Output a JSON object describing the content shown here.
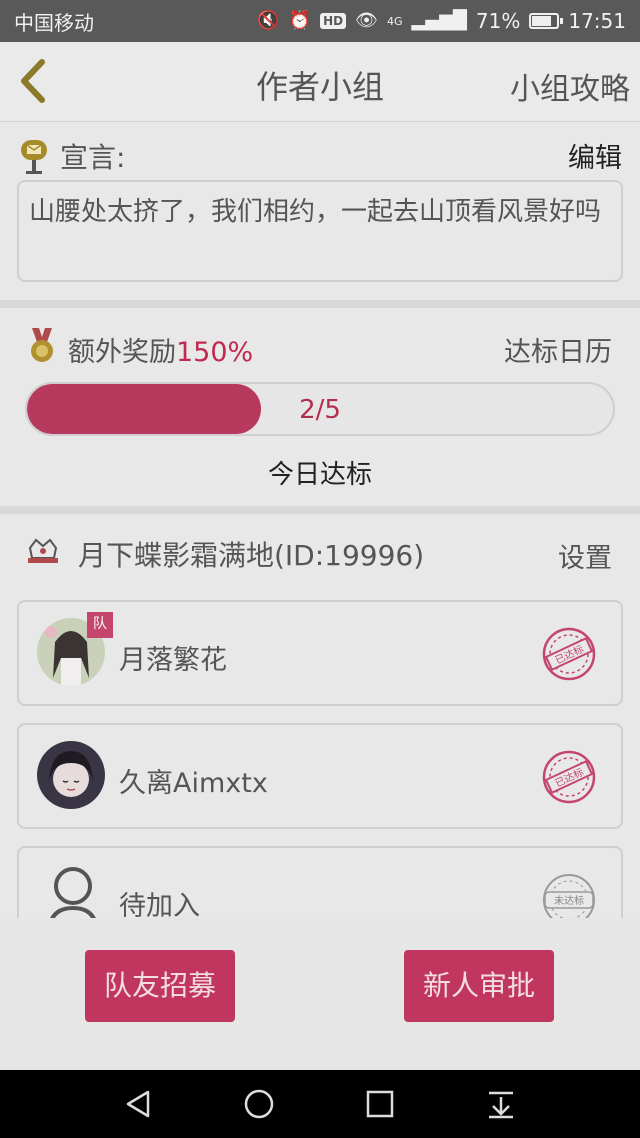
{
  "status_bar": {
    "carrier": "中国移动",
    "network": "4G",
    "battery": "71%",
    "time": "17:51"
  },
  "header": {
    "title": "作者小组",
    "right_link": "小组攻略"
  },
  "declaration": {
    "label": "宣言:",
    "edit": "编辑",
    "text": "山腰处太挤了，我们相约，一起去山顶看风景好吗"
  },
  "reward": {
    "label": "额外奖励",
    "percent": "150%",
    "calendar_link": "达标日历",
    "progress_text": "2/5",
    "progress_fraction": 0.4,
    "today_label": "今日达标"
  },
  "team": {
    "name": "月下蝶影霜满地(ID:19996)",
    "settings": "设置",
    "members": [
      {
        "name": "月落繁花",
        "badge": "队",
        "status": "已达标"
      },
      {
        "name": "久离Aimxtx",
        "status": "已达标"
      },
      {
        "name": "待加入",
        "status": "未达标"
      }
    ]
  },
  "buttons": {
    "recruit": "队友招募",
    "approve": "新人审批"
  },
  "colors": {
    "accent": "#c1365f",
    "progress_fill": "#b8395e",
    "highlight_text": "#c0294f"
  }
}
